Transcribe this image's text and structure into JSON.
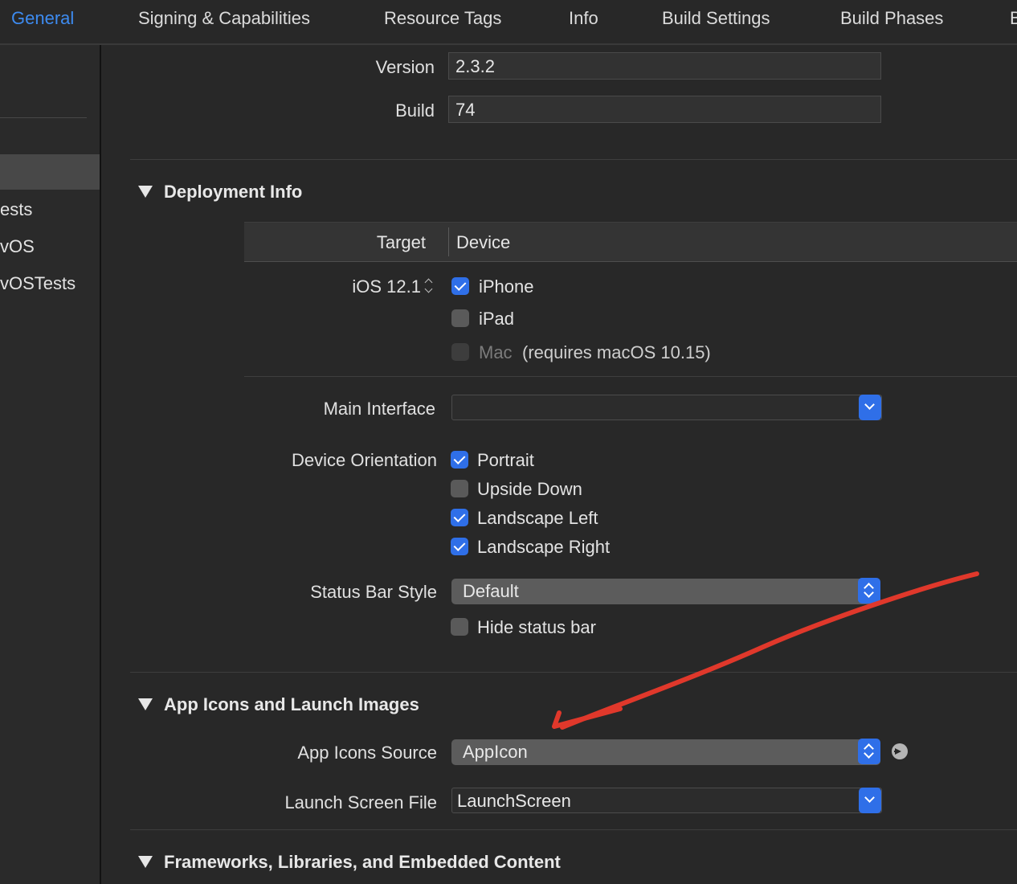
{
  "tabs": [
    {
      "label": "General",
      "active": true
    },
    {
      "label": "Signing & Capabilities",
      "active": false
    },
    {
      "label": "Resource Tags",
      "active": false
    },
    {
      "label": "Info",
      "active": false
    },
    {
      "label": "Build Settings",
      "active": false
    },
    {
      "label": "Build Phases",
      "active": false
    },
    {
      "label": "B",
      "active": false
    }
  ],
  "sidebar": {
    "items": [
      {
        "label": "ests"
      },
      {
        "label": "vOS"
      },
      {
        "label": "vOSTests"
      }
    ]
  },
  "identity": {
    "version_label": "Version",
    "version_value": "2.3.2",
    "build_label": "Build",
    "build_value": "74"
  },
  "deployment": {
    "title": "Deployment Info",
    "table": {
      "target_header": "Target",
      "device_header": "Device"
    },
    "target_value": "iOS 12.1",
    "devices": [
      {
        "label": "iPhone",
        "checked": true,
        "enabled": true
      },
      {
        "label": "iPad",
        "checked": false,
        "enabled": true
      },
      {
        "label": "Mac",
        "checked": false,
        "enabled": false,
        "note": "(requires macOS 10.15)"
      }
    ],
    "main_interface_label": "Main Interface",
    "main_interface_value": "",
    "orientation_label": "Device Orientation",
    "orientations": [
      {
        "label": "Portrait",
        "checked": true
      },
      {
        "label": "Upside Down",
        "checked": false
      },
      {
        "label": "Landscape Left",
        "checked": true
      },
      {
        "label": "Landscape Right",
        "checked": true
      }
    ],
    "status_bar_label": "Status Bar Style",
    "status_bar_value": "Default",
    "hide_status_bar": {
      "label": "Hide status bar",
      "checked": false
    }
  },
  "app_icons": {
    "title": "App Icons and Launch Images",
    "source_label": "App Icons Source",
    "source_value": "AppIcon",
    "launch_label": "Launch Screen File",
    "launch_value": "LaunchScreen"
  },
  "frameworks": {
    "title": "Frameworks, Libraries, and Embedded Content"
  },
  "annotation": {
    "color": "#e0382b"
  },
  "colors": {
    "accent": "#3d8bf0",
    "checkbox_on": "#2f6fe8",
    "background": "#282828"
  }
}
